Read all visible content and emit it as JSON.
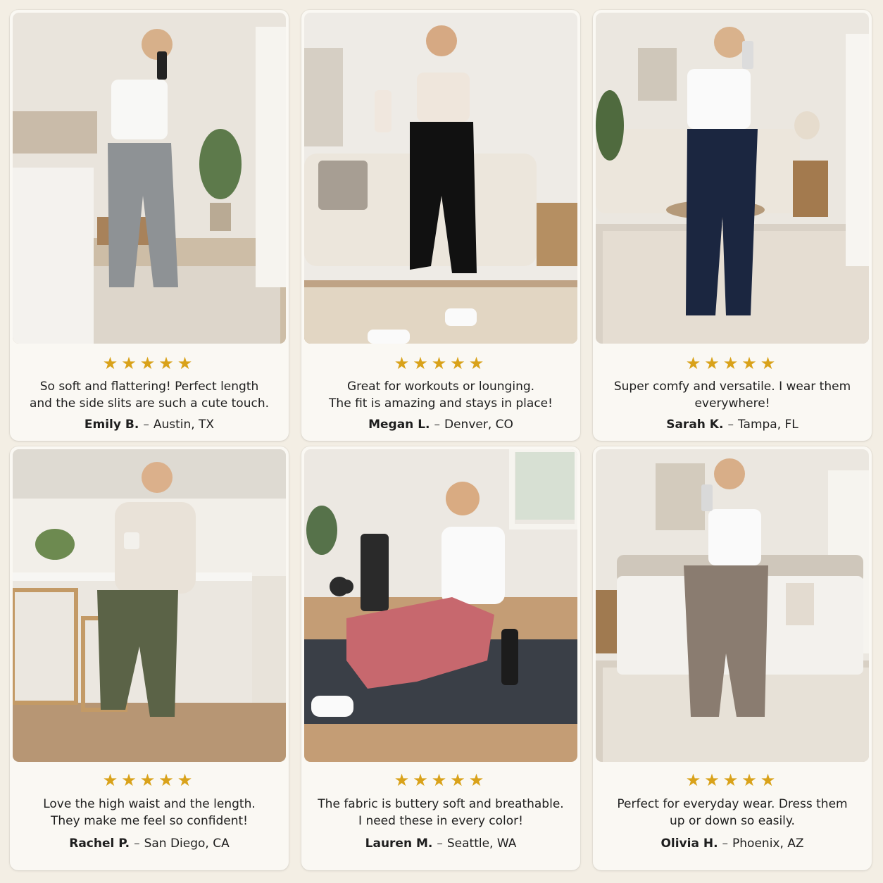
{
  "colors": {
    "background": "#f3eee4",
    "card": "#faf8f3",
    "star": "#d9a21a",
    "text": "#1e1e1e"
  },
  "separator": "–",
  "reviews": [
    {
      "rating": 5,
      "stars": "★★★★★",
      "quote_lines": [
        "So soft and flattering! Perfect length",
        "and the side slits are such a cute touch."
      ],
      "name": "Emily B.",
      "location": "Austin, TX",
      "legging_color": "#8e9295",
      "scene": "bedroom"
    },
    {
      "rating": 5,
      "stars": "★★★★★",
      "quote_lines": [
        "Great for workouts or lounging.",
        "The fit is amazing and stays in place!"
      ],
      "name": "Megan L.",
      "location": "Denver, CO",
      "legging_color": "#111111",
      "scene": "living-room"
    },
    {
      "rating": 5,
      "stars": "★★★★★",
      "quote_lines": [
        "Super comfy and versatile. I wear them",
        "everywhere!"
      ],
      "name": "Sarah K.",
      "location": "Tampa, FL",
      "legging_color": "#1b2640",
      "scene": "living-room"
    },
    {
      "rating": 5,
      "stars": "★★★★★",
      "quote_lines": [
        "Love the high waist and the length.",
        "They make me feel so confident!"
      ],
      "name": "Rachel P.",
      "location": "San Diego, CA",
      "legging_color": "#5b6347",
      "scene": "kitchen"
    },
    {
      "rating": 5,
      "stars": "★★★★★",
      "quote_lines": [
        "The fabric is buttery soft and breathable.",
        "I need these in every color!"
      ],
      "name": "Lauren M.",
      "location": "Seattle, WA",
      "legging_color": "#c7686e",
      "scene": "yoga-mat"
    },
    {
      "rating": 5,
      "stars": "★★★★★",
      "quote_lines": [
        "Perfect for everyday wear. Dress them",
        "up or down so easily."
      ],
      "name": "Olivia H.",
      "location": "Phoenix, AZ",
      "legging_color": "#8a7c70",
      "scene": "bedroom"
    }
  ]
}
